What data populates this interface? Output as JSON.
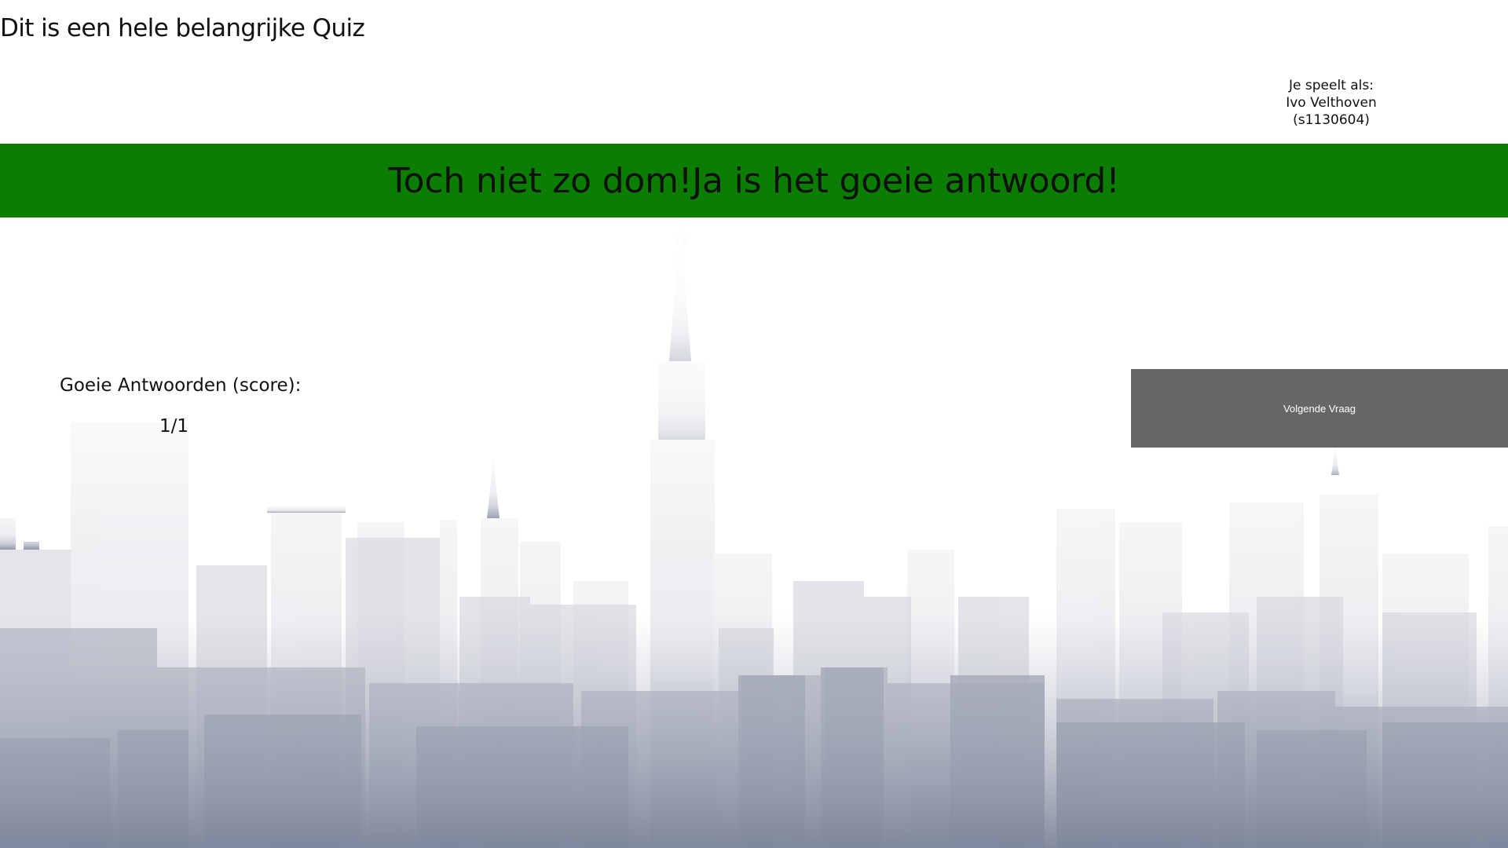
{
  "header": {
    "title": "Dit is een hele belangrijke Quiz"
  },
  "player": {
    "label": "Je speelt als:",
    "name": "Ivo Velthoven",
    "id": "(s1130604)"
  },
  "feedback": {
    "message": "Toch niet zo dom!Ja is het goeie antwoord!",
    "color": "#0b7d02"
  },
  "score": {
    "label": "Goeie Antwoorden (score):",
    "value": "1/1"
  },
  "actions": {
    "next_label": "Volgende Vraag"
  },
  "background": {
    "icon": "city-skyline-illustration",
    "gradient_top": "#ffffff",
    "gradient_bottom": "#7d879a"
  }
}
